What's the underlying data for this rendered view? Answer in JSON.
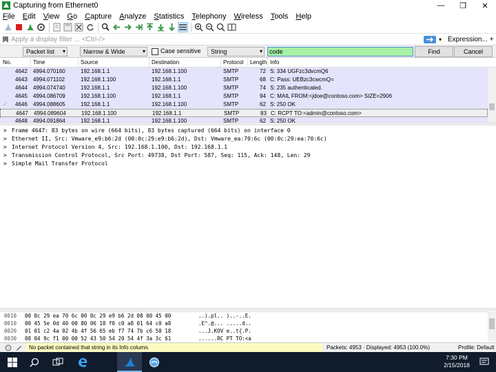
{
  "window": {
    "title": "Capturing from Ethernet0",
    "minimize": "—",
    "maximize": "❐",
    "close": "✕"
  },
  "menu": [
    "File",
    "Edit",
    "View",
    "Go",
    "Capture",
    "Analyze",
    "Statistics",
    "Telephony",
    "Wireless",
    "Tools",
    "Help"
  ],
  "filter": {
    "placeholder": "Apply a display filter ... <Ctrl-/>",
    "expression_label": "Expression...",
    "plus": "+"
  },
  "find": {
    "search_in": "Packet list",
    "char_width": "Narrow & Wide",
    "case_sensitive_label": "Case sensitive",
    "search_type": "String",
    "query": "code",
    "find_label": "Find",
    "cancel_label": "Cancel"
  },
  "packet_list": {
    "columns": [
      "No.",
      "Time",
      "Source",
      "Destination",
      "Protocol",
      "Length",
      "Info"
    ],
    "rows": [
      {
        "no": "4642",
        "time": "4994.070160",
        "src": "192.168.1.1",
        "dst": "192.168.1.100",
        "proto": "SMTP",
        "len": "72",
        "info": "S: 334 UGFzc3dvcmQ6",
        "bg": "#e4e4fc"
      },
      {
        "no": "4643",
        "time": "4994.071102",
        "src": "192.168.1.100",
        "dst": "192.168.1.1",
        "proto": "SMTP",
        "len": "68",
        "info": "C: Pass: UEBzc3cwcmQ=",
        "bg": "#e4e4fc"
      },
      {
        "no": "4644",
        "time": "4994.074740",
        "src": "192.168.1.1",
        "dst": "192.168.1.100",
        "proto": "SMTP",
        "len": "74",
        "info": "S: 235 authenticated.",
        "bg": "#e4e4fc"
      },
      {
        "no": "4645",
        "time": "4994.086709",
        "src": "192.168.1.100",
        "dst": "192.168.1.1",
        "proto": "SMTP",
        "len": "94",
        "info": "C: MAIL FROM:<jdoe@contoso.com> SIZE=2906",
        "bg": "#e4e4fc"
      },
      {
        "no": "4646",
        "time": "4994.088605",
        "src": "192.168.1.1",
        "dst": "192.168.1.100",
        "proto": "SMTP",
        "len": "62",
        "info": "S: 250 OK",
        "bg": "#e4e4fc"
      },
      {
        "no": "4647",
        "time": "4994.089604",
        "src": "192.168.1.100",
        "dst": "192.168.1.1",
        "proto": "SMTP",
        "len": "83",
        "info": "C: RCPT TO:<admin@contoso.com>",
        "bg": "#f0f0f0"
      },
      {
        "no": "4648",
        "time": "4994.091864",
        "src": "192.168.1.1",
        "dst": "192.168.1.100",
        "proto": "SMTP",
        "len": "62",
        "info": "S: 250 OK",
        "bg": "#e4e4fc"
      }
    ]
  },
  "details": [
    "Frame 4647: 83 bytes on wire (664 bits), 83 bytes captured (664 bits) on interface 0",
    "Ethernet II, Src: Vmware_e9:b6:2d (00:0c:29:e9:b6:2d), Dst: Vmware_ea:70:6c (00:0c:29:ea:70:6c)",
    "Internet Protocol Version 4, Src: 192.168.1.100, Dst: 192.168.1.1",
    "Transmission Control Protocol, Src Port: 49738, Dst Port: 587, Seq: 115, Ack: 148, Len: 29",
    "Simple Mail Transfer Protocol"
  ],
  "bytes": [
    {
      "offset": "0010",
      "hex": "00 0c 29 ea 70 6c 00 0c  29 e9 b6 2d 08 00 45 00",
      "ascii": "..).pl.. )..-..E."
    },
    {
      "offset": "0010",
      "hex": "00 45 5e 0d 40 00 80 06  18 f0 c0 a8 01 64 c0 a8",
      "ascii": ".E^.@... .....d.."
    },
    {
      "offset": "0020",
      "hex": "01 01 c2 4a 02 4b 4f 56  65 eb f7 74 7b c6 50 18",
      "ascii": "...J.KOV e..t{.P."
    },
    {
      "offset": "0030",
      "hex": "08 04 9c f1 00 00 52 43  50 54 20 54 4f 3a 3c 61",
      "ascii": "......RC PT TO:<a"
    }
  ],
  "status": {
    "message": "No packet contained that string in its Info column.",
    "packets": "Packets: 4953 · Displayed: 4953 (100.0%)",
    "profile": "Profile: Default"
  },
  "taskbar": {
    "time": "7:30 PM",
    "date": "2/15/2018"
  },
  "icons": [
    "wireshark-app-icon",
    "shark-fin-start-icon",
    "stop-capture-icon",
    "restart-capture-icon",
    "capture-options-icon",
    "open-file-icon",
    "save-file-icon",
    "close-file-icon",
    "reload-icon",
    "find-packet-icon",
    "go-back-icon",
    "go-forward-icon",
    "go-to-packet-icon",
    "first-packet-icon",
    "last-packet-icon",
    "autoscroll-icon",
    "colorize-icon",
    "zoom-in-icon",
    "zoom-out-icon",
    "normal-size-icon",
    "resize-columns-icon",
    "windows-start-icon",
    "search-icon",
    "task-view-icon",
    "edge-icon",
    "wireshark-taskbar-icon",
    "network-capture-icon"
  ]
}
